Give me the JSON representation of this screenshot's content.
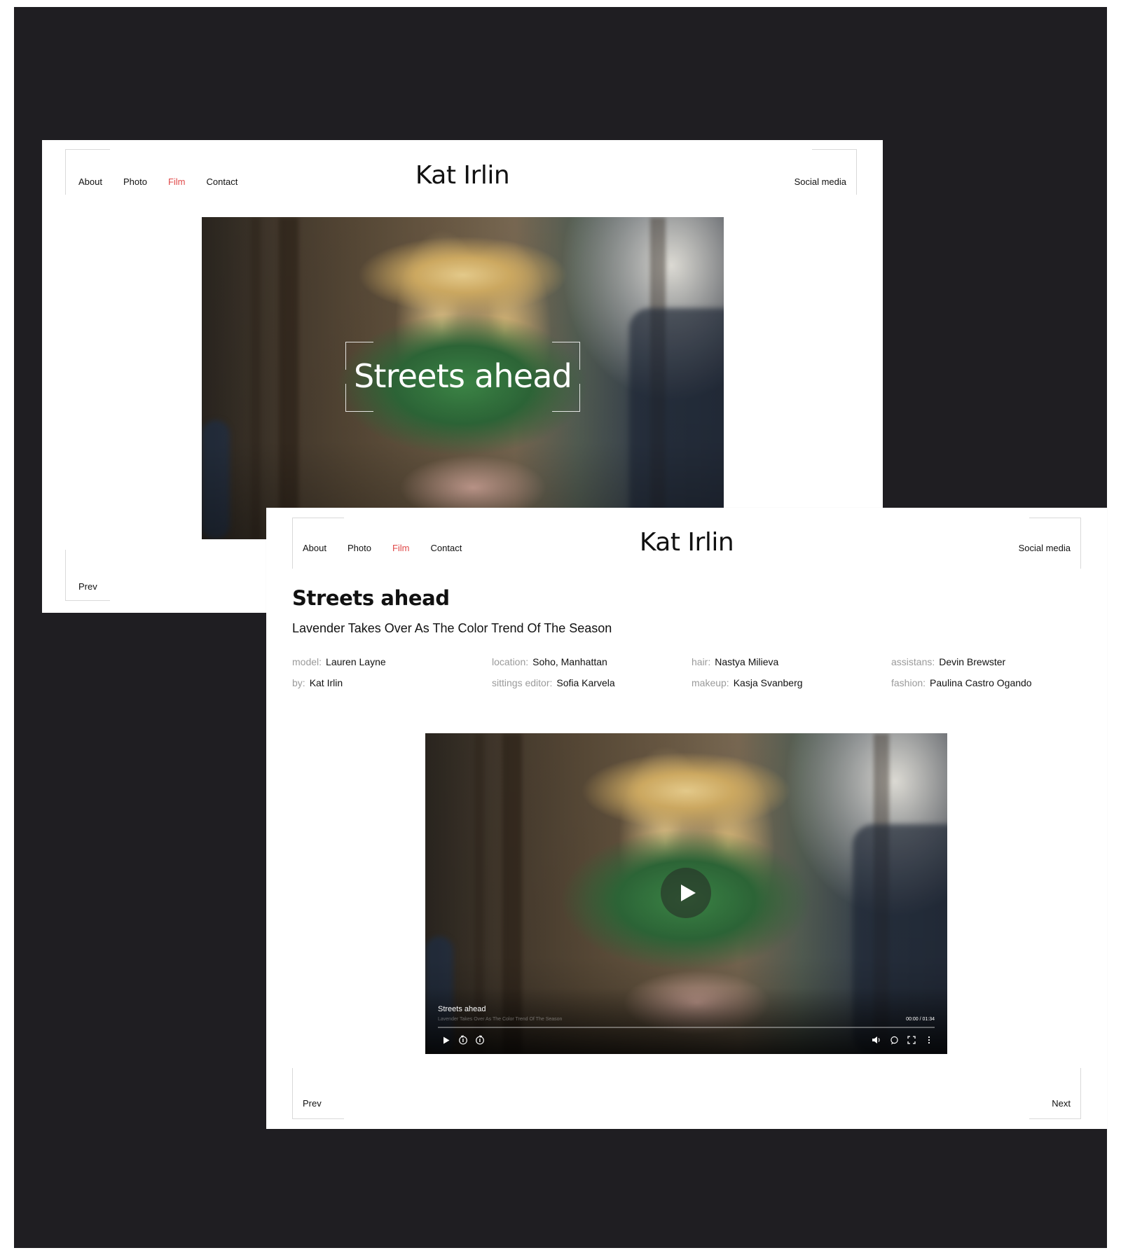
{
  "back_page": {
    "nav": [
      "About",
      "Photo",
      "Film",
      "Contact"
    ],
    "active_nav": "Film",
    "brand": "Kat Irlin",
    "social": "Social media",
    "hero_title": "Streets ahead",
    "prev": "Prev"
  },
  "front_page": {
    "nav": [
      "About",
      "Photo",
      "Film",
      "Contact"
    ],
    "active_nav": "Film",
    "brand": "Kat Irlin",
    "social": "Social media",
    "title": "Streets ahead",
    "subtitle": "Lavender Takes Over As The Color Trend Of The Season",
    "credits": [
      {
        "key": "model:",
        "value": "Lauren Layne"
      },
      {
        "key": "location:",
        "value": "Soho, Manhattan"
      },
      {
        "key": "hair:",
        "value": "Nastya Milieva"
      },
      {
        "key": "assistans:",
        "value": "Devin Brewster"
      },
      {
        "key": "by:",
        "value": "Kat Irlin"
      },
      {
        "key": "sittings editor:",
        "value": "Sofia Karvela"
      },
      {
        "key": "makeup:",
        "value": "Kasja Svanberg"
      },
      {
        "key": "fashion:",
        "value": "Paulina Castro Ogando"
      }
    ],
    "video": {
      "title": "Streets ahead",
      "subtitle": "Lavender Takes Over As The Color Trend Of The Season",
      "time": "00:00 / 01:34",
      "progress": 0
    },
    "prev": "Prev",
    "next": "Next"
  },
  "colors": {
    "backdrop": "#1f1e22",
    "accent": "#e04848",
    "muted": "#9a9a9a"
  },
  "icons": [
    "play-icon",
    "rewind-10-icon",
    "forward-10-icon",
    "volume-icon",
    "subtitles-icon",
    "fullscreen-icon",
    "more-icon"
  ]
}
